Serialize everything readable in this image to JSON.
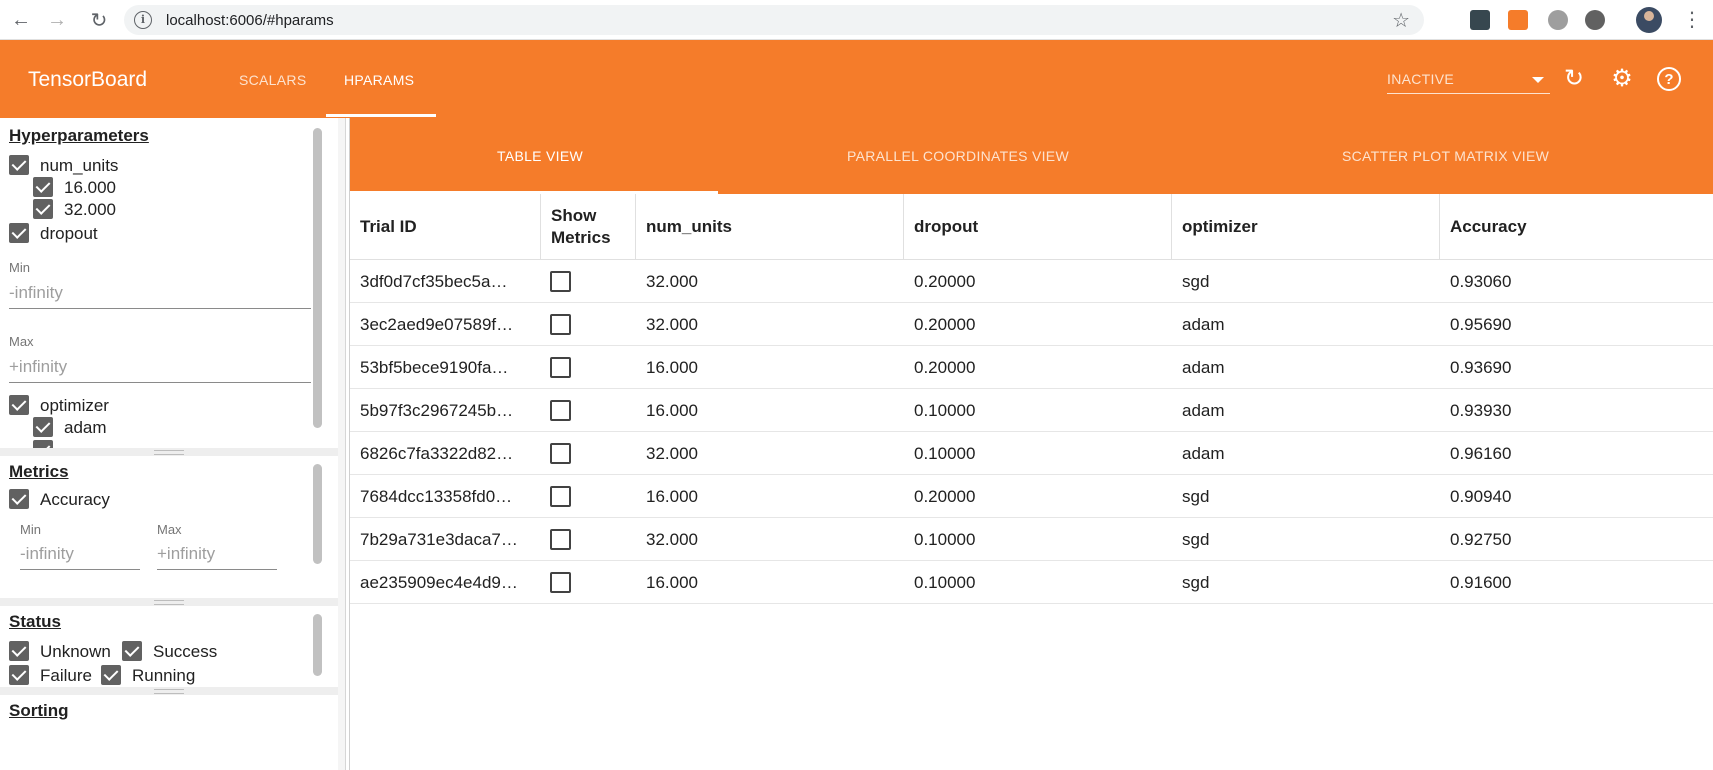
{
  "browser": {
    "url": "localhost:6006/#hparams"
  },
  "header": {
    "title": "TensorBoard",
    "tabs": [
      {
        "label": "SCALARS",
        "active": false
      },
      {
        "label": "HPARAMS",
        "active": true
      }
    ],
    "run_select_value": "INACTIVE"
  },
  "sidebar": {
    "hyperparameters": {
      "title": "Hyperparameters",
      "num_units_label": "num_units",
      "num_units_values": [
        "16.000",
        "32.000"
      ],
      "dropout_label": "dropout",
      "min_label": "Min",
      "min_value": "-infinity",
      "max_label": "Max",
      "max_value": "+infinity",
      "optimizer_label": "optimizer",
      "optimizer_values": [
        "adam"
      ]
    },
    "metrics": {
      "title": "Metrics",
      "accuracy_label": "Accuracy",
      "min_label": "Min",
      "min_value": "-infinity",
      "max_label": "Max",
      "max_value": "+infinity"
    },
    "status": {
      "title": "Status",
      "options": [
        "Unknown",
        "Success",
        "Failure",
        "Running"
      ]
    },
    "sorting": {
      "title": "Sorting"
    }
  },
  "view_tabs": [
    {
      "label": "TABLE VIEW",
      "active": true
    },
    {
      "label": "PARALLEL COORDINATES VIEW",
      "active": false
    },
    {
      "label": "SCATTER PLOT MATRIX VIEW",
      "active": false
    }
  ],
  "table": {
    "columns": [
      "Trial ID",
      "Show Metrics",
      "num_units",
      "dropout",
      "optimizer",
      "Accuracy"
    ],
    "show_metrics_header": [
      "Show",
      "Metrics"
    ],
    "rows": [
      {
        "trial_id": "3df0d7cf35bec5a…",
        "num_units": "32.000",
        "dropout": "0.20000",
        "optimizer": "sgd",
        "accuracy": "0.93060"
      },
      {
        "trial_id": "3ec2aed9e07589f…",
        "num_units": "32.000",
        "dropout": "0.20000",
        "optimizer": "adam",
        "accuracy": "0.95690"
      },
      {
        "trial_id": "53bf5bece9190fa…",
        "num_units": "16.000",
        "dropout": "0.20000",
        "optimizer": "adam",
        "accuracy": "0.93690"
      },
      {
        "trial_id": "5b97f3c2967245b…",
        "num_units": "16.000",
        "dropout": "0.10000",
        "optimizer": "adam",
        "accuracy": "0.93930"
      },
      {
        "trial_id": "6826c7fa3322d82…",
        "num_units": "32.000",
        "dropout": "0.10000",
        "optimizer": "adam",
        "accuracy": "0.96160"
      },
      {
        "trial_id": "7684dcc13358fd0…",
        "num_units": "16.000",
        "dropout": "0.20000",
        "optimizer": "sgd",
        "accuracy": "0.90940"
      },
      {
        "trial_id": "7b29a731e3daca7…",
        "num_units": "32.000",
        "dropout": "0.10000",
        "optimizer": "sgd",
        "accuracy": "0.92750"
      },
      {
        "trial_id": "ae235909ec4e4d9…",
        "num_units": "16.000",
        "dropout": "0.10000",
        "optimizer": "sgd",
        "accuracy": "0.91600"
      }
    ]
  },
  "colors": {
    "brand": "#f57c2a",
    "checkbox": "#616161"
  },
  "icons": [
    "back-arrow-icon",
    "forward-arrow-icon",
    "reload-icon",
    "info-icon",
    "star-icon",
    "refresh-icon",
    "gear-icon",
    "help-icon",
    "dropdown-caret-icon",
    "checkbox-checked-icon"
  ]
}
